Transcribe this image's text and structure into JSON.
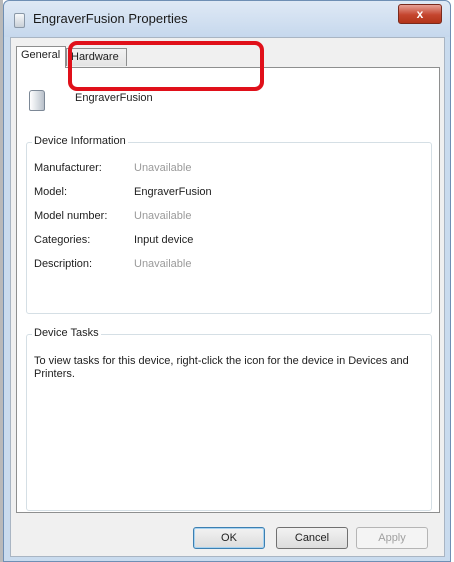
{
  "window": {
    "title": "EngraverFusion Properties",
    "close_glyph": "x"
  },
  "tabs": [
    {
      "label": "General",
      "active": true
    },
    {
      "label": "Hardware",
      "active": false
    }
  ],
  "device": {
    "name": "EngraverFusion",
    "icon": "device-icon"
  },
  "device_information": {
    "group_label": "Device Information",
    "rows": [
      {
        "label": "Manufacturer:",
        "value": "Unavailable",
        "dim": true
      },
      {
        "label": "Model:",
        "value": "EngraverFusion",
        "dim": false
      },
      {
        "label": "Model number:",
        "value": "Unavailable",
        "dim": true
      },
      {
        "label": "Categories:",
        "value": "Input device",
        "dim": false
      },
      {
        "label": "Description:",
        "value": "Unavailable",
        "dim": true
      }
    ]
  },
  "device_tasks": {
    "group_label": "Device Tasks",
    "text": "To view tasks for this device, right-click the icon for the device in Devices and Printers."
  },
  "buttons": {
    "ok": "OK",
    "cancel": "Cancel",
    "apply": "Apply"
  },
  "colors": {
    "highlight": "#e0101a",
    "dim_text": "#9a9a9a"
  }
}
